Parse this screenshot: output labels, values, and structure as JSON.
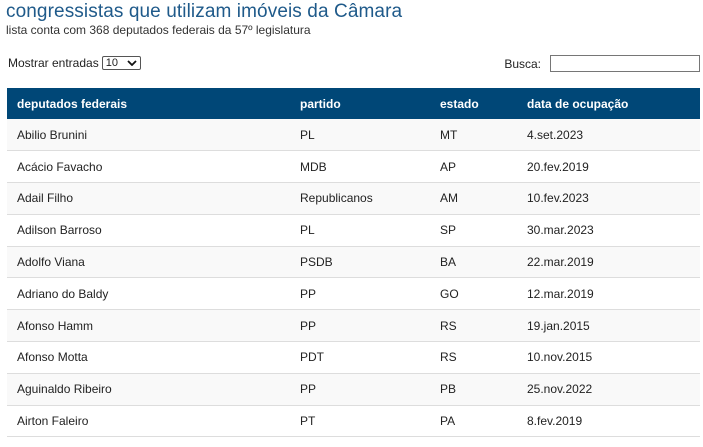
{
  "header": {
    "title": "congressistas que utilizam imóveis da Câmara",
    "subtitle": "lista conta com 368 deputados federais da 57º legislatura"
  },
  "controls": {
    "length_label": "Mostrar entradas",
    "length_value": "10",
    "search_label": "Busca:",
    "search_value": ""
  },
  "table": {
    "columns": [
      "deputados federais",
      "partido",
      "estado",
      "data de ocupação"
    ],
    "rows": [
      [
        "Abilio Brunini",
        "PL",
        "MT",
        "4.set.2023"
      ],
      [
        "Acácio Favacho",
        "MDB",
        "AP",
        "20.fev.2019"
      ],
      [
        "Adail Filho",
        "Republicanos",
        "AM",
        "10.fev.2023"
      ],
      [
        "Adilson Barroso",
        "PL",
        "SP",
        "30.mar.2023"
      ],
      [
        "Adolfo Viana",
        "PSDB",
        "BA",
        "22.mar.2019"
      ],
      [
        "Adriano do Baldy",
        "PP",
        "GO",
        "12.mar.2019"
      ],
      [
        "Afonso Hamm",
        "PP",
        "RS",
        "19.jan.2015"
      ],
      [
        "Afonso Motta",
        "PDT",
        "RS",
        "10.nov.2015"
      ],
      [
        "Aguinaldo Ribeiro",
        "PP",
        "PB",
        "25.nov.2022"
      ],
      [
        "Airton Faleiro",
        "PT",
        "PA",
        "8.fev.2019"
      ]
    ]
  },
  "colors": {
    "header_bg": "#004777",
    "title": "#1f5a8a"
  }
}
